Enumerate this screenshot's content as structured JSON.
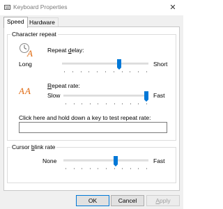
{
  "window": {
    "title": "Keyboard Properties",
    "close_glyph": "✕"
  },
  "tabs": [
    {
      "label": "Speed",
      "selected": true
    },
    {
      "label": "Hardware",
      "selected": false
    }
  ],
  "character_repeat": {
    "group_label": "Character repeat",
    "repeat_delay": {
      "label_pre": "Repeat ",
      "label_accel": "d",
      "label_post": "elay:",
      "left": "Long",
      "right": "Short",
      "value_fraction": 0.67,
      "icon": "repeat-delay-icon"
    },
    "repeat_rate": {
      "label_pre": "",
      "label_accel": "R",
      "label_post": "epeat rate:",
      "left": "Slow",
      "right": "Fast",
      "value_fraction": 1.0,
      "icon": "repeat-rate-icon"
    },
    "test_prompt": "Click here and hold down a key to test repeat rate:",
    "test_value": ""
  },
  "cursor_blink": {
    "group_label_pre": "Cursor ",
    "group_label_accel": "b",
    "group_label_post": "link rate",
    "left": "None",
    "right": "Fast",
    "value_fraction": 0.62
  },
  "buttons": {
    "ok": "OK",
    "cancel": "Cancel",
    "apply_accel": "A",
    "apply_post": "pply"
  },
  "colors": {
    "accent": "#0078d7"
  }
}
